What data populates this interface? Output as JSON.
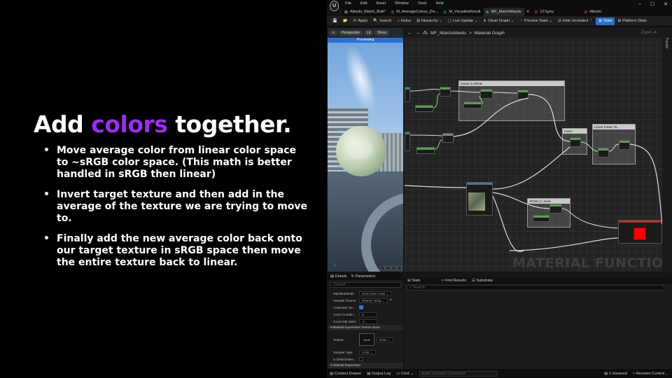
{
  "slide": {
    "title_start": "Add ",
    "title_accent": "colors",
    "title_end": " together.",
    "bullets": [
      "Move average color from linear color space to ~sRGB color space. (This math is better handled in sRGB then linear)",
      "Invert target texture and then add in the average of the texture we are trying to move to.",
      "Finally add the new average color back onto our target texture in sRGB space then move the entire texture back to linear."
    ],
    "accent_color": "#9b2df0"
  },
  "editor": {
    "logo": "U",
    "menu": [
      "File",
      "Edit",
      "Asset",
      "Window",
      "Tools",
      "Help"
    ],
    "window_controls": [
      "–",
      "☐",
      "✕"
    ],
    "tabs": [
      {
        "label": "Albedo_Match_Bulk*",
        "icon": "⊞"
      },
      {
        "label": "M_AverageColour_Dis...",
        "icon": "◎"
      },
      {
        "label": "M_VisualizeResult",
        "icon": "◎"
      },
      {
        "label": "MF_MatchAlbedo",
        "icon": "⊗",
        "active": true
      },
      {
        "label": "✕",
        "icon": ""
      },
      {
        "label": "127grey",
        "icon": "⊘"
      },
      {
        "label": "Albedo",
        "icon": "⊘"
      }
    ],
    "toolbar": [
      {
        "label": "",
        "icon": "💾"
      },
      {
        "label": "",
        "icon": "📁"
      },
      {
        "label": "Apply",
        "icon": "⟳"
      },
      {
        "label": "Search",
        "icon": "🔍"
      },
      {
        "label": "Home",
        "icon": "⌂"
      },
      {
        "label": "Hierarchy ⌄",
        "icon": "⊞"
      },
      {
        "label": "Live Update ⌄",
        "icon": "▢"
      },
      {
        "label": "Clean Graph ⌄",
        "icon": "⋔"
      },
      {
        "label": "Preview State ⌄",
        "icon": "⁘"
      },
      {
        "label": "Hide Unrelated ⋮",
        "icon": "⊟"
      },
      {
        "label": "Stats",
        "icon": "⊞",
        "active": true
      },
      {
        "label": "Platform Stats",
        "icon": "⊞"
      }
    ],
    "viewport": {
      "buttons": [
        "Perspective",
        "Lit",
        "Show"
      ],
      "previewing": "Previewing"
    },
    "graph": {
      "breadcrumb_asset": "MF_MatchAlbedo",
      "breadcrumb_sep": ">",
      "breadcrumb_view": "Material Graph",
      "zoom": "Zoom -4",
      "watermark": "MATERIAL FUNCTION",
      "groups": [
        "Linear to sRGB",
        "Invert",
        "Linear Power Ta...",
        "sRGB to Linear"
      ],
      "side_label": "Palette"
    },
    "details": {
      "tab_details": "Details",
      "tab_parameters": "Parameters",
      "search_placeholder": "Search",
      "rows": [
        {
          "label": "MipValueMode",
          "value": "None (use comp ⌄"
        },
        {
          "label": "Sampler Source",
          "value": "Shared: Wrap ⌄"
        },
        {
          "label": "Automatic Vie..."
        },
        {
          "label": "Const Coordin...",
          "value": "0"
        },
        {
          "label": "Const Mip Value",
          "value": "-1"
        }
      ],
      "section_texture_base": "Material Expression Texture Base",
      "texture_label": "Texture",
      "texture_thumb": "None",
      "texture_dropdown": "None ⌄",
      "sampler_type_label": "Sampler Type",
      "sampler_type_value": "Color ⌄",
      "is_default_label": "Is Default Mes...",
      "section_expression": "Material Expression"
    },
    "stats": {
      "tab_stats": "Stats",
      "tab_find": "Find Results",
      "tab_substrate": "Substrate",
      "search_placeholder": "Search"
    },
    "statusbar": {
      "content_drawer": "Content Drawer",
      "output_log": "Output Log",
      "cmd": "Cmd ⌄",
      "console_placeholder": "Enter Console Command",
      "unsaved": "1 Unsaved",
      "revision": "Revision Control ⌄"
    }
  }
}
